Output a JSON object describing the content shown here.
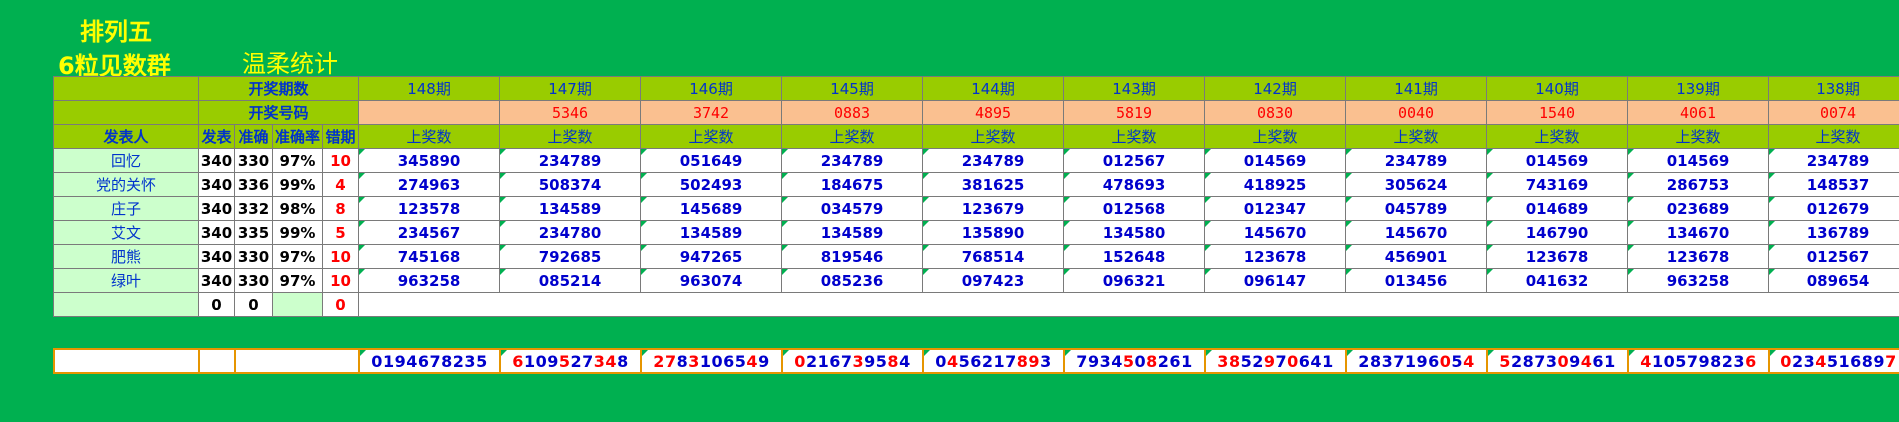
{
  "titles": {
    "line1": "排列五",
    "line2": "6粒见数群",
    "subtitle": "温柔统计"
  },
  "header": {
    "draw_period_label": "开奖期数",
    "draw_number_label": "开奖号码",
    "publisher_label": "发表人",
    "published_label": "发表",
    "correct_label": "准确",
    "rate_label": "准确率",
    "miss_label": "错期",
    "winning_label": "上奖数"
  },
  "periods": [
    "148期",
    "147期",
    "146期",
    "145期",
    "144期",
    "143期",
    "142期",
    "141期",
    "140期",
    "139期",
    "138期"
  ],
  "draw_numbers": [
    "",
    "5346",
    "3742",
    "0883",
    "4895",
    "5819",
    "0830",
    "0040",
    "1540",
    "4061",
    "0074"
  ],
  "rows": [
    {
      "name": "回忆",
      "published": "340",
      "correct": "330",
      "rate": "97%",
      "miss": "10",
      "numbers": [
        "345890",
        "234789",
        "051649",
        "234789",
        "234789",
        "012567",
        "014569",
        "234789",
        "014569",
        "014569",
        "234789"
      ]
    },
    {
      "name": "党的关怀",
      "published": "340",
      "correct": "336",
      "rate": "99%",
      "miss": "4",
      "numbers": [
        "274963",
        "508374",
        "502493",
        "184675",
        "381625",
        "478693",
        "418925",
        "305624",
        "743169",
        "286753",
        "148537"
      ]
    },
    {
      "name": "庄子",
      "published": "340",
      "correct": "332",
      "rate": "98%",
      "miss": "8",
      "numbers": [
        "123578",
        "134589",
        "145689",
        "034579",
        "123679",
        "012568",
        "012347",
        "045789",
        "014689",
        "023689",
        "012679"
      ]
    },
    {
      "name": "艾文",
      "published": "340",
      "correct": "335",
      "rate": "99%",
      "miss": "5",
      "numbers": [
        "234567",
        "234780",
        "134589",
        "134589",
        "135890",
        "134580",
        "145670",
        "145670",
        "146790",
        "134670",
        "136789"
      ]
    },
    {
      "name": "肥熊",
      "published": "340",
      "correct": "330",
      "rate": "97%",
      "miss": "10",
      "numbers": [
        "745168",
        "792685",
        "947265",
        "819546",
        "768514",
        "152648",
        "123678",
        "456901",
        "123678",
        "123678",
        "012567"
      ]
    },
    {
      "name": "绿叶",
      "published": "340",
      "correct": "330",
      "rate": "97%",
      "miss": "10",
      "numbers": [
        "963258",
        "085214",
        "963074",
        "085236",
        "097423",
        "096321",
        "096147",
        "013456",
        "041632",
        "963258",
        "089654"
      ]
    }
  ],
  "totals": {
    "name": "",
    "published": "0",
    "correct": "0",
    "rate": "",
    "miss": "0"
  },
  "digit_sequences": [
    [
      [
        "0",
        "b"
      ],
      [
        "1",
        "b"
      ],
      [
        "9",
        "b"
      ],
      [
        "4",
        "b"
      ],
      [
        "6",
        "b"
      ],
      [
        "7",
        "b"
      ],
      [
        "8",
        "b"
      ],
      [
        "2",
        "b"
      ],
      [
        "3",
        "b"
      ],
      [
        "5",
        "b"
      ]
    ],
    [
      [
        "6",
        "r"
      ],
      [
        "1",
        "b"
      ],
      [
        "0",
        "b"
      ],
      [
        "9",
        "b"
      ],
      [
        "5",
        "r"
      ],
      [
        "2",
        "b"
      ],
      [
        "7",
        "b"
      ],
      [
        "3",
        "r"
      ],
      [
        "4",
        "r"
      ],
      [
        "8",
        "b"
      ]
    ],
    [
      [
        "2",
        "r"
      ],
      [
        "7",
        "r"
      ],
      [
        "8",
        "b"
      ],
      [
        "3",
        "r"
      ],
      [
        "1",
        "b"
      ],
      [
        "0",
        "b"
      ],
      [
        "6",
        "b"
      ],
      [
        "5",
        "b"
      ],
      [
        "4",
        "r"
      ],
      [
        "9",
        "b"
      ]
    ],
    [
      [
        "0",
        "r"
      ],
      [
        "2",
        "b"
      ],
      [
        "1",
        "b"
      ],
      [
        "6",
        "b"
      ],
      [
        "7",
        "b"
      ],
      [
        "3",
        "r"
      ],
      [
        "9",
        "b"
      ],
      [
        "5",
        "b"
      ],
      [
        "8",
        "r"
      ],
      [
        "4",
        "b"
      ]
    ],
    [
      [
        "0",
        "b"
      ],
      [
        "4",
        "r"
      ],
      [
        "5",
        "b"
      ],
      [
        "6",
        "b"
      ],
      [
        "2",
        "b"
      ],
      [
        "1",
        "b"
      ],
      [
        "7",
        "b"
      ],
      [
        "8",
        "r"
      ],
      [
        "9",
        "r"
      ],
      [
        "3",
        "b"
      ]
    ],
    [
      [
        "7",
        "b"
      ],
      [
        "9",
        "b"
      ],
      [
        "3",
        "b"
      ],
      [
        "4",
        "b"
      ],
      [
        "5",
        "r"
      ],
      [
        "0",
        "b"
      ],
      [
        "8",
        "r"
      ],
      [
        "2",
        "b"
      ],
      [
        "6",
        "b"
      ],
      [
        "1",
        "b"
      ]
    ],
    [
      [
        "3",
        "r"
      ],
      [
        "8",
        "r"
      ],
      [
        "5",
        "b"
      ],
      [
        "2",
        "b"
      ],
      [
        "9",
        "r"
      ],
      [
        "7",
        "b"
      ],
      [
        "0",
        "r"
      ],
      [
        "6",
        "b"
      ],
      [
        "4",
        "b"
      ],
      [
        "1",
        "b"
      ]
    ],
    [
      [
        "2",
        "b"
      ],
      [
        "8",
        "b"
      ],
      [
        "3",
        "b"
      ],
      [
        "7",
        "b"
      ],
      [
        "1",
        "b"
      ],
      [
        "9",
        "b"
      ],
      [
        "6",
        "b"
      ],
      [
        "0",
        "r"
      ],
      [
        "5",
        "b"
      ],
      [
        "4",
        "r"
      ]
    ],
    [
      [
        "5",
        "r"
      ],
      [
        "2",
        "b"
      ],
      [
        "8",
        "b"
      ],
      [
        "7",
        "b"
      ],
      [
        "3",
        "b"
      ],
      [
        "0",
        "r"
      ],
      [
        "9",
        "b"
      ],
      [
        "4",
        "r"
      ],
      [
        "6",
        "b"
      ],
      [
        "1",
        "b"
      ]
    ],
    [
      [
        "4",
        "r"
      ],
      [
        "1",
        "b"
      ],
      [
        "0",
        "b"
      ],
      [
        "5",
        "b"
      ],
      [
        "7",
        "b"
      ],
      [
        "9",
        "b"
      ],
      [
        "8",
        "b"
      ],
      [
        "2",
        "b"
      ],
      [
        "3",
        "b"
      ],
      [
        "6",
        "r"
      ]
    ],
    [
      [
        "0",
        "r"
      ],
      [
        "2",
        "b"
      ],
      [
        "3",
        "b"
      ],
      [
        "4",
        "r"
      ],
      [
        "5",
        "b"
      ],
      [
        "1",
        "b"
      ],
      [
        "6",
        "b"
      ],
      [
        "8",
        "b"
      ],
      [
        "9",
        "b"
      ],
      [
        "7",
        "r"
      ]
    ]
  ],
  "colors": {
    "background": "#00b050",
    "header": "#99cc00",
    "draw_cell": "#fac090",
    "name_cell": "#ccffcc",
    "number": "#0000cc",
    "highlight": "#ff0000",
    "bottom_border": "#e69500"
  }
}
